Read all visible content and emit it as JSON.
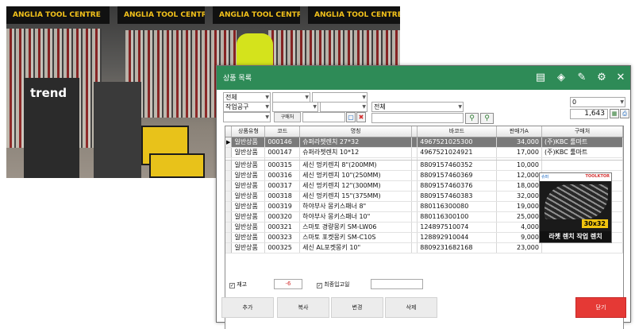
{
  "photo": {
    "banners": [
      "ANGLIA TOOL CENTRE",
      "ANGLIA TOOL CENTRE",
      "ANGLIA TOOL CENTRE",
      "ANGLIA TOOL CENTRE"
    ],
    "sign_text": "trend"
  },
  "window": {
    "title": "상품 목록",
    "icons": [
      "book-icon",
      "tag-icon",
      "edit-icon",
      "gear-icon",
      "close-icon"
    ]
  },
  "filters": {
    "category1": "전체",
    "category2": "작업공구",
    "category3": "전체",
    "buyer_button": "구매처",
    "count_select": "0",
    "total_count": "1,643"
  },
  "table": {
    "headers": [
      "상품유형",
      "코드",
      "명칭",
      "바코드",
      "판매가A",
      "구매처"
    ],
    "rows": [
      [
        "일반상품",
        "000146",
        "슈퍼라쳇렌치 27*32",
        "4967521025300",
        "34,000",
        "(주)KBC 툴마트"
      ],
      [
        "일반상품",
        "000147",
        "슈퍼라쳇렌치 10*12",
        "4967521024921",
        "17,000",
        "(주)KBC 툴마트"
      ],
      [
        "일반상품",
        "000315",
        "세신 멍키렌치 8\"(200MM)",
        "8809157460352",
        "10,000",
        ""
      ],
      [
        "일반상품",
        "000316",
        "세신 멍키렌치 10\"(250MM)",
        "8809157460369",
        "12,000",
        ""
      ],
      [
        "일반상품",
        "000317",
        "세신 멍키렌치 12\"(300MM)",
        "8809157460376",
        "18,000",
        ""
      ],
      [
        "일반상품",
        "000318",
        "세신 멍키렌치 15\"(375MM)",
        "8809157460383",
        "32,000",
        ""
      ],
      [
        "일반상품",
        "000319",
        "하야부사 몽키스패너 8\"",
        "880116300080",
        "19,000",
        ""
      ],
      [
        "일반상품",
        "000320",
        "하야부사 몽키스패너 10\"",
        "880116300100",
        "25,000",
        ""
      ],
      [
        "일반상품",
        "000321",
        "스마토 경량몽키 SM-LW06",
        "124897510074",
        "4,000",
        ""
      ],
      [
        "일반상품",
        "000323",
        "스마토 포켓몽키 SM-C10S",
        "128892910044",
        "9,000",
        ""
      ],
      [
        "일반상품",
        "000325",
        "세신 AL포켓몽키 10\"",
        "8809231682168",
        "23,000",
        ""
      ]
    ]
  },
  "preview": {
    "brand": "TOOLKTOR",
    "logo": "슈퍼",
    "size": "30x32",
    "caption": "라쳇 렌치 작업 렌치"
  },
  "footer": {
    "stock_label": "재고",
    "stock_value": "-6",
    "last_in_label": "최종입고일",
    "last_in_value": "",
    "buttons": {
      "add": "추가",
      "copy": "복사",
      "change": "변경",
      "delete": "삭제",
      "close": "닫기"
    }
  },
  "colors": {
    "titlebar": "#2e8b57",
    "close_button": "#e53935",
    "selected_row": "#7a7a7a"
  }
}
